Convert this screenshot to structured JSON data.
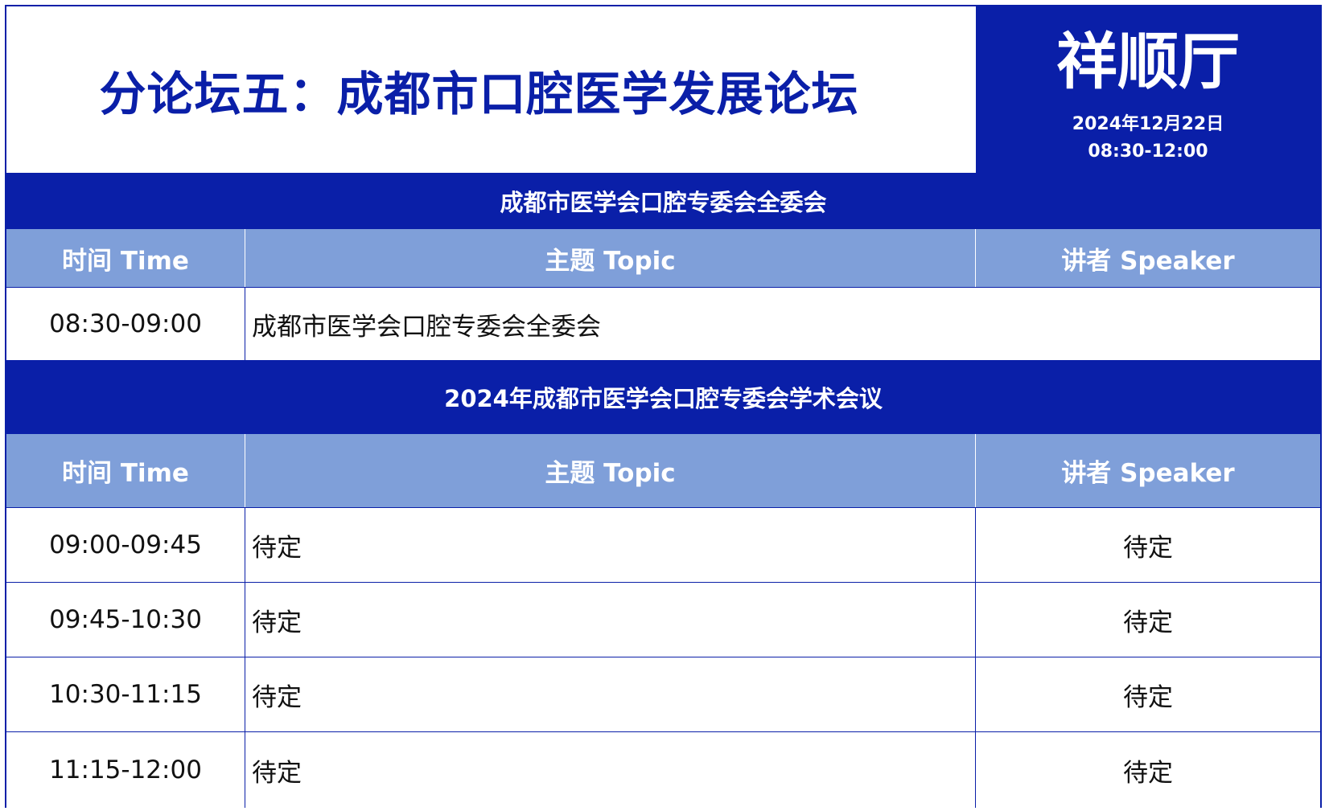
{
  "header": {
    "title": "分论坛五：成都市口腔医学发展论坛",
    "venue": "祥顺厅",
    "date": "2024年12月22日",
    "time": "08:30-12:00"
  },
  "columns": {
    "time": "时间 Time",
    "topic": "主题 Topic",
    "speaker": "讲者 Speaker"
  },
  "section1": {
    "title": "成都市医学会口腔专委会全委会",
    "rows": [
      {
        "time": "08:30-09:00",
        "topic": "成都市医学会口腔专委会全委会"
      }
    ]
  },
  "section2": {
    "title": "2024年成都市医学会口腔专委会学术会议",
    "rows": [
      {
        "time": "09:00-09:45",
        "topic": "待定",
        "speaker": "待定"
      },
      {
        "time": "09:45-10:30",
        "topic": "待定",
        "speaker": "待定"
      },
      {
        "time": "10:30-11:15",
        "topic": "待定",
        "speaker": "待定"
      },
      {
        "time": "11:15-12:00",
        "topic": "待定",
        "speaker": "待定"
      }
    ]
  },
  "colors": {
    "primary": "#0a1fa8",
    "header_row": "#7f9fd9",
    "text": "#111111"
  }
}
